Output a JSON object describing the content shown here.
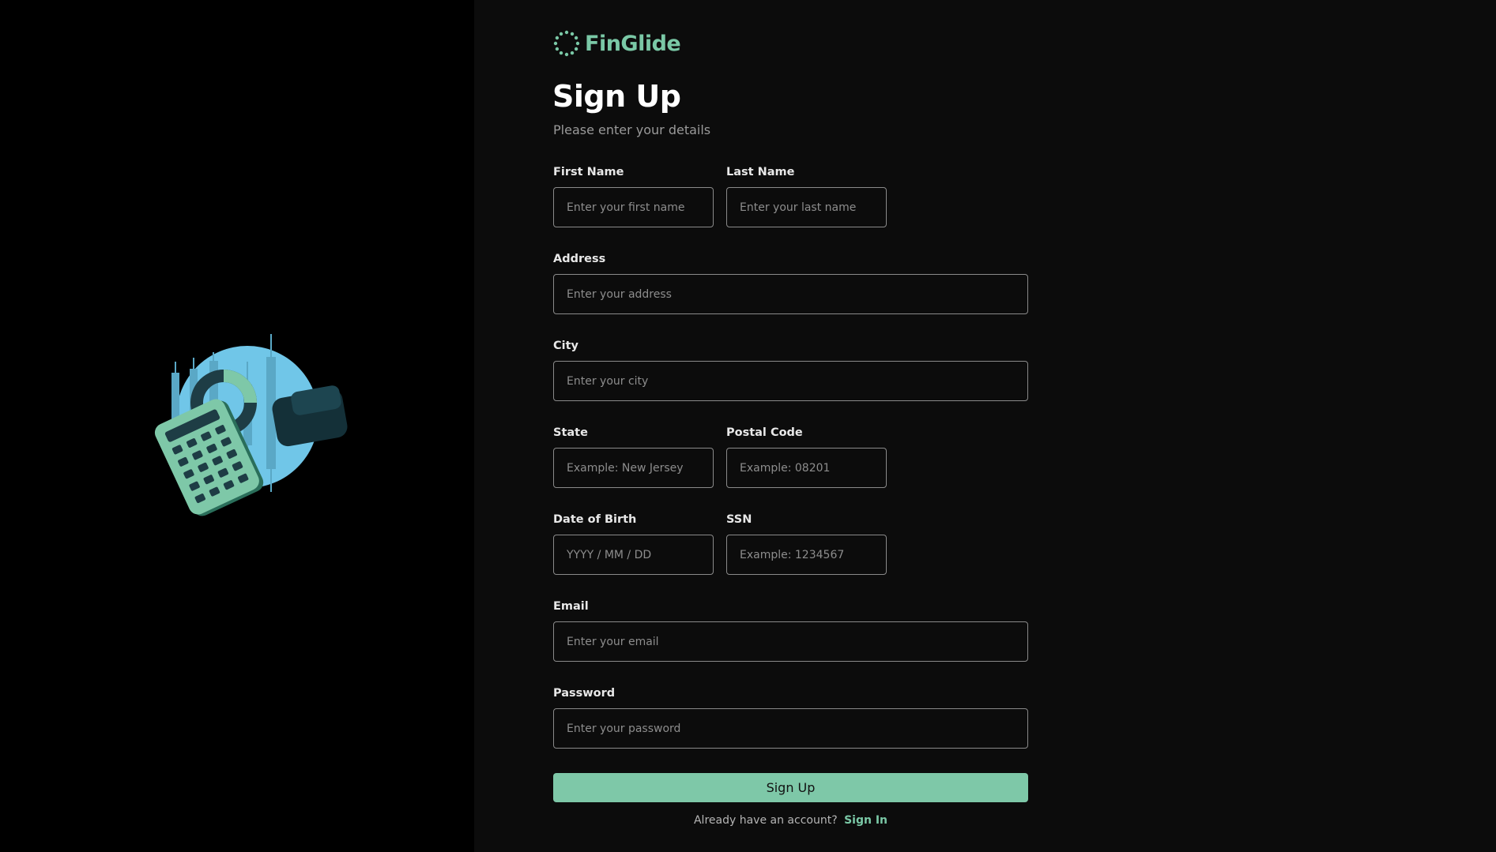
{
  "brand": {
    "name": "FinGlide",
    "accent_color": "#7ac8a6"
  },
  "heading": {
    "title": "Sign Up",
    "subtitle": "Please enter your details"
  },
  "form": {
    "first_name": {
      "label": "First Name",
      "placeholder": "Enter your first name",
      "value": ""
    },
    "last_name": {
      "label": "Last Name",
      "placeholder": "Enter your last name",
      "value": ""
    },
    "address": {
      "label": "Address",
      "placeholder": "Enter your address",
      "value": ""
    },
    "city": {
      "label": "City",
      "placeholder": "Enter your city",
      "value": ""
    },
    "state": {
      "label": "State",
      "placeholder": "Example: New Jersey",
      "value": ""
    },
    "postal_code": {
      "label": "Postal Code",
      "placeholder": "Example: 08201",
      "value": ""
    },
    "dob": {
      "label": "Date of Birth",
      "placeholder": "YYYY / MM / DD",
      "value": ""
    },
    "ssn": {
      "label": "SSN",
      "placeholder": "Example: 1234567",
      "value": ""
    },
    "email": {
      "label": "Email",
      "placeholder": "Enter your email",
      "value": ""
    },
    "password": {
      "label": "Password",
      "placeholder": "Enter your password",
      "value": ""
    },
    "submit_label": "Sign Up"
  },
  "footer": {
    "prompt": "Already have an account?",
    "link_label": "Sign In"
  },
  "illustration": {
    "icons": [
      "calculator-icon",
      "credit-card-icon",
      "donut-chart-icon",
      "candlestick-chart-icon"
    ]
  }
}
